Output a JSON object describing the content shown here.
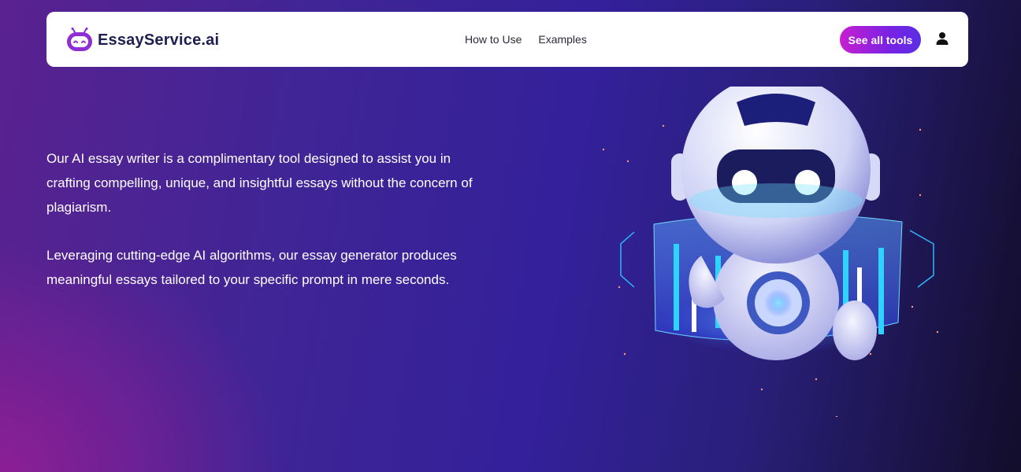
{
  "navbar": {
    "logo_text": "EssayService.ai",
    "links": [
      "How to Use",
      "Examples"
    ],
    "cta_label": "See all tools",
    "user_icon": "user-icon"
  },
  "hero": {
    "paragraphs": [
      "Our AI essay writer is a complimentary tool designed to assist you in crafting compelling, unique, and insightful essays without the concern of plagiarism.",
      "Leveraging cutting-edge AI algorithms, our essay generator produces meaningful essays tailored to your specific prompt in mere seconds."
    ]
  },
  "colors": {
    "brand_text": "#1e1f4e",
    "cta_gradient_start": "#c71fd0",
    "cta_gradient_end": "#5a2ee6",
    "bg_purple": "#3f2596"
  },
  "illustration": {
    "icon": "robot-illustration"
  }
}
